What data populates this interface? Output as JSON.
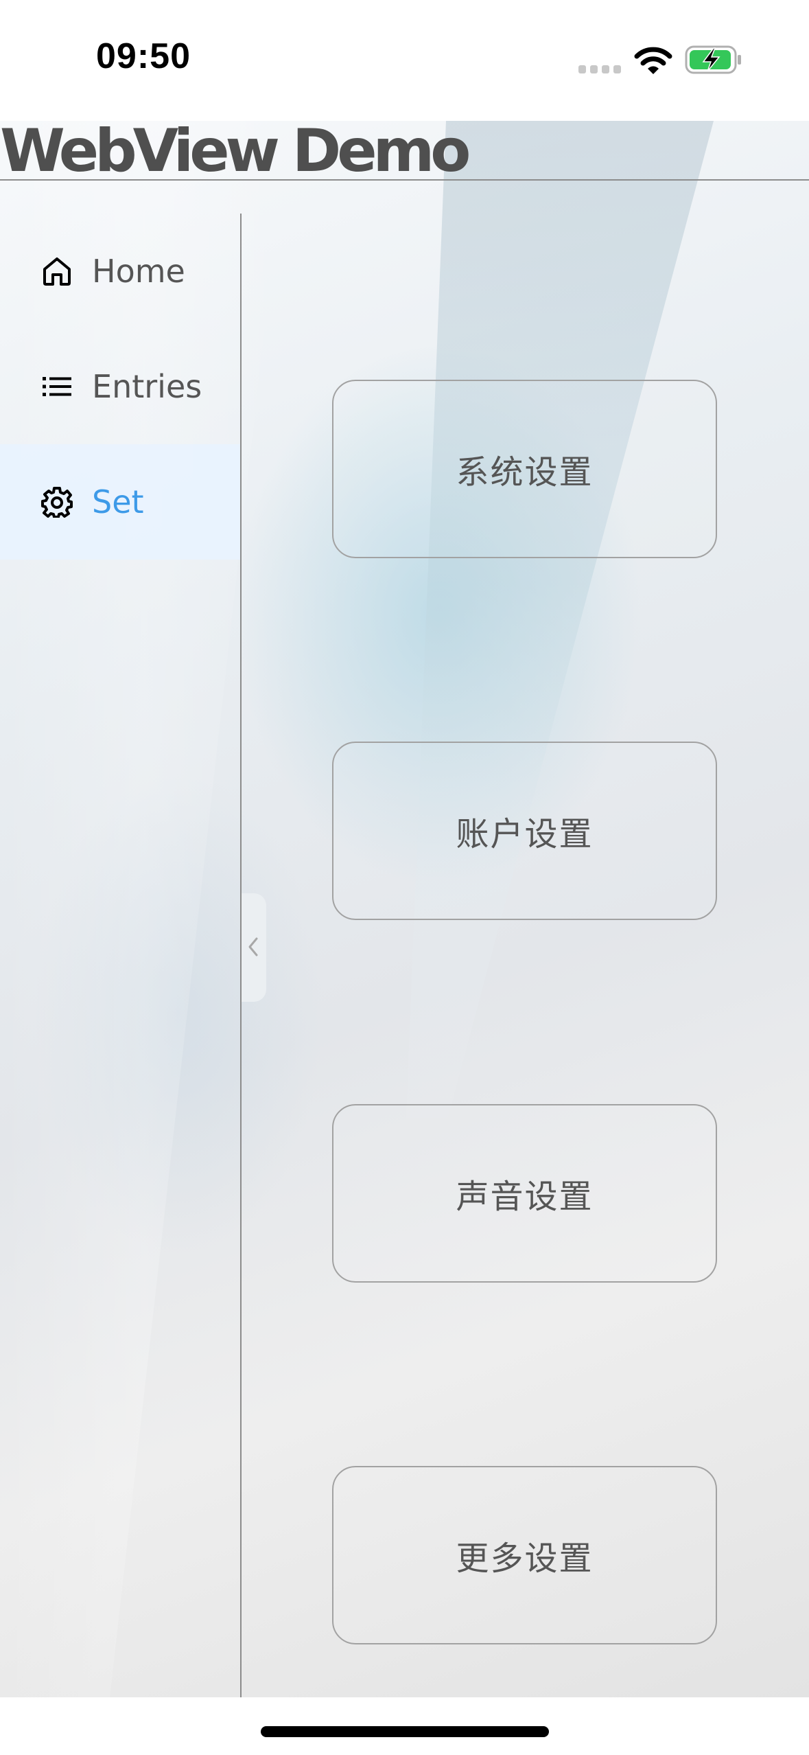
{
  "status_bar": {
    "time": "09:50"
  },
  "app": {
    "title": "WebView Demo"
  },
  "sidebar": {
    "items": [
      {
        "label": "Home",
        "icon": "home-icon",
        "active": false
      },
      {
        "label": "Entries",
        "icon": "list-icon",
        "active": false
      },
      {
        "label": "Set",
        "icon": "gear-icon",
        "active": true
      }
    ],
    "collapse_icon": "chevron-left-icon"
  },
  "settings": {
    "buttons": [
      {
        "label": "系统设置"
      },
      {
        "label": "账户设置"
      },
      {
        "label": "声音设置"
      },
      {
        "label": "更多设置"
      }
    ]
  },
  "colors": {
    "accent": "#3d9ae8",
    "text": "#555555",
    "title": "#4f4f4f",
    "active_bg": "#e8f2ff",
    "battery_green": "#34c759"
  }
}
